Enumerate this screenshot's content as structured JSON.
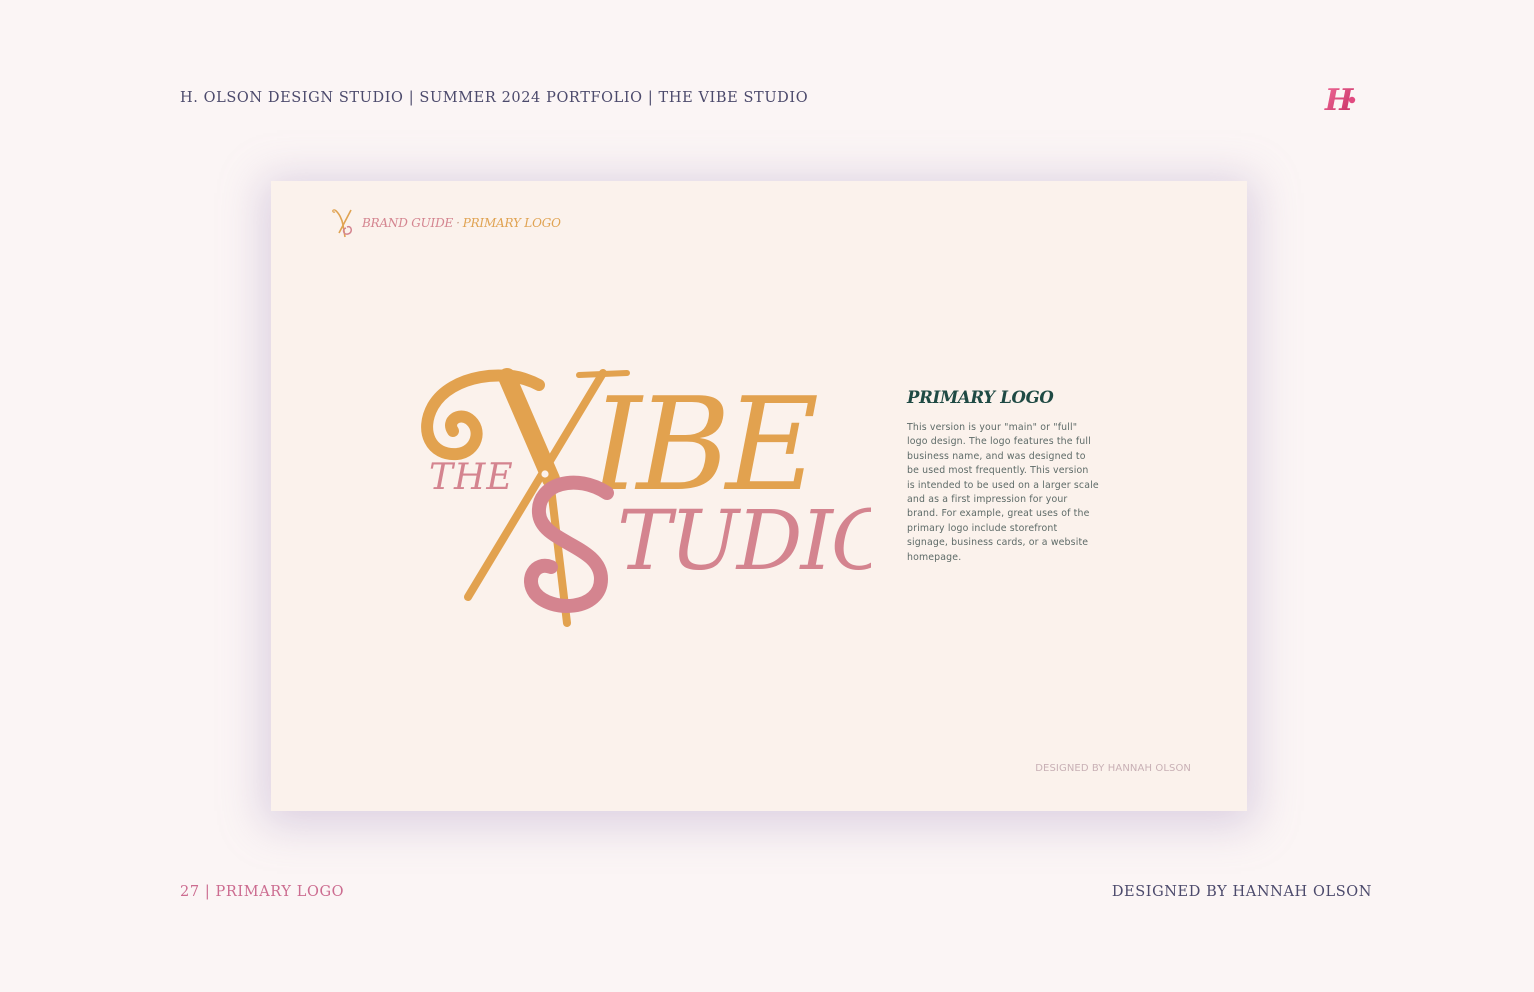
{
  "header": {
    "title": "H. OLSON DESIGN STUDIO | SUMMER 2024 PORTFOLIO | THE VIBE STUDIO",
    "mark_letter": "H",
    "mark_icon": "h-monogram-icon"
  },
  "card": {
    "breadcrumb": {
      "icon": "scissors-monogram-icon",
      "part1": "BRAND GUIDE",
      "separator": "·",
      "part2": "PRIMARY LOGO"
    },
    "logo": {
      "word_the": "THE",
      "word_vibe_rest": "IBE",
      "word_studio_rest": "TUDIO",
      "icon": "scissors-icon"
    },
    "info": {
      "title": "PRIMARY LOGO",
      "body": "This version is your \"main\" or \"full\" logo design. The logo features the full business name, and was designed to be used most frequently. This version is intended to be used on a larger scale and as a first impression for your brand. For example, great uses of the primary logo include storefront signage, business cards, or a website homepage."
    },
    "credit": "DESIGNED BY HANNAH OLSON"
  },
  "footer": {
    "left": "27 | PRIMARY LOGO",
    "right": "DESIGNED BY HANNAH OLSON"
  },
  "colors": {
    "page_bg": "#fbf5f5",
    "card_bg": "#fbf2ec",
    "gold": "#e2a24f",
    "rose": "#d4848f",
    "navy": "#4c4a6c",
    "pink": "#cc6c90",
    "teal": "#1f4a44"
  }
}
